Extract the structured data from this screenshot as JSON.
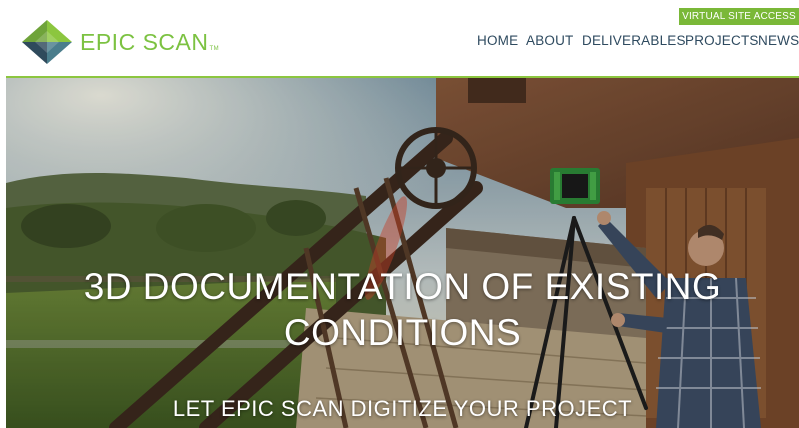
{
  "header": {
    "brand": "EPIC SCAN",
    "trademark": "TM",
    "virtual_access": "VIRTUAL SITE ACCESS",
    "nav": [
      {
        "label": "HOME"
      },
      {
        "label": "ABOUT"
      },
      {
        "label": "DELIVERABLES"
      },
      {
        "label": "PROJECTS"
      },
      {
        "label": "NEWS"
      }
    ]
  },
  "hero": {
    "title_line1": "3D DOCUMENTATION OF EXISTING",
    "title_line2": "CONDITIONS",
    "subtitle": "LET EPIC SCAN DIGITIZE YOUR PROJECT",
    "image_subject": "technician operating a green 3D laser scanner on a tripod beside a historic wooden building"
  },
  "colors": {
    "brand_green": "#7cc242",
    "nav_text": "#2e4a5f",
    "logo_dark": "#2f4a5c",
    "logo_teal": "#4a7d8c",
    "logo_green": "#8cc63f"
  }
}
